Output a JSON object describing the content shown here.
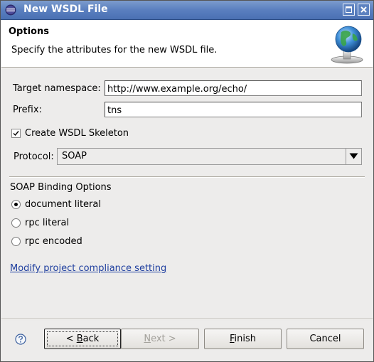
{
  "window": {
    "title": "New WSDL File"
  },
  "header": {
    "title": "Options",
    "description": "Specify the attributes for the new WSDL file."
  },
  "form": {
    "target_namespace_label": "Target namespace:",
    "target_namespace_value": "http://www.example.org/echo/",
    "prefix_label": "Prefix:",
    "prefix_value": "tns",
    "create_skeleton_label": "Create WSDL Skeleton",
    "create_skeleton_checked": true,
    "protocol_label": "Protocol:",
    "protocol_value": "SOAP"
  },
  "soap_binding": {
    "title": "SOAP Binding Options",
    "options": [
      {
        "label": "document literal",
        "selected": true
      },
      {
        "label": "rpc literal",
        "selected": false
      },
      {
        "label": "rpc encoded",
        "selected": false
      }
    ]
  },
  "link": {
    "label": "Modify project compliance setting"
  },
  "buttons": {
    "back_mnemonic": "B",
    "back_rest": "ack",
    "back_prefix": "< ",
    "next_mnemonic": "N",
    "next_rest": "ext >",
    "finish_mnemonic": "F",
    "finish_rest": "inish",
    "cancel": "Cancel"
  },
  "icons": {
    "app": "eclipse-icon",
    "header_image": "wsdl-globe-icon",
    "help": "help-icon"
  },
  "colors": {
    "titlebar": "#5a7fbf",
    "dialog_bg": "#edeceb",
    "link": "#1f3f9f"
  }
}
